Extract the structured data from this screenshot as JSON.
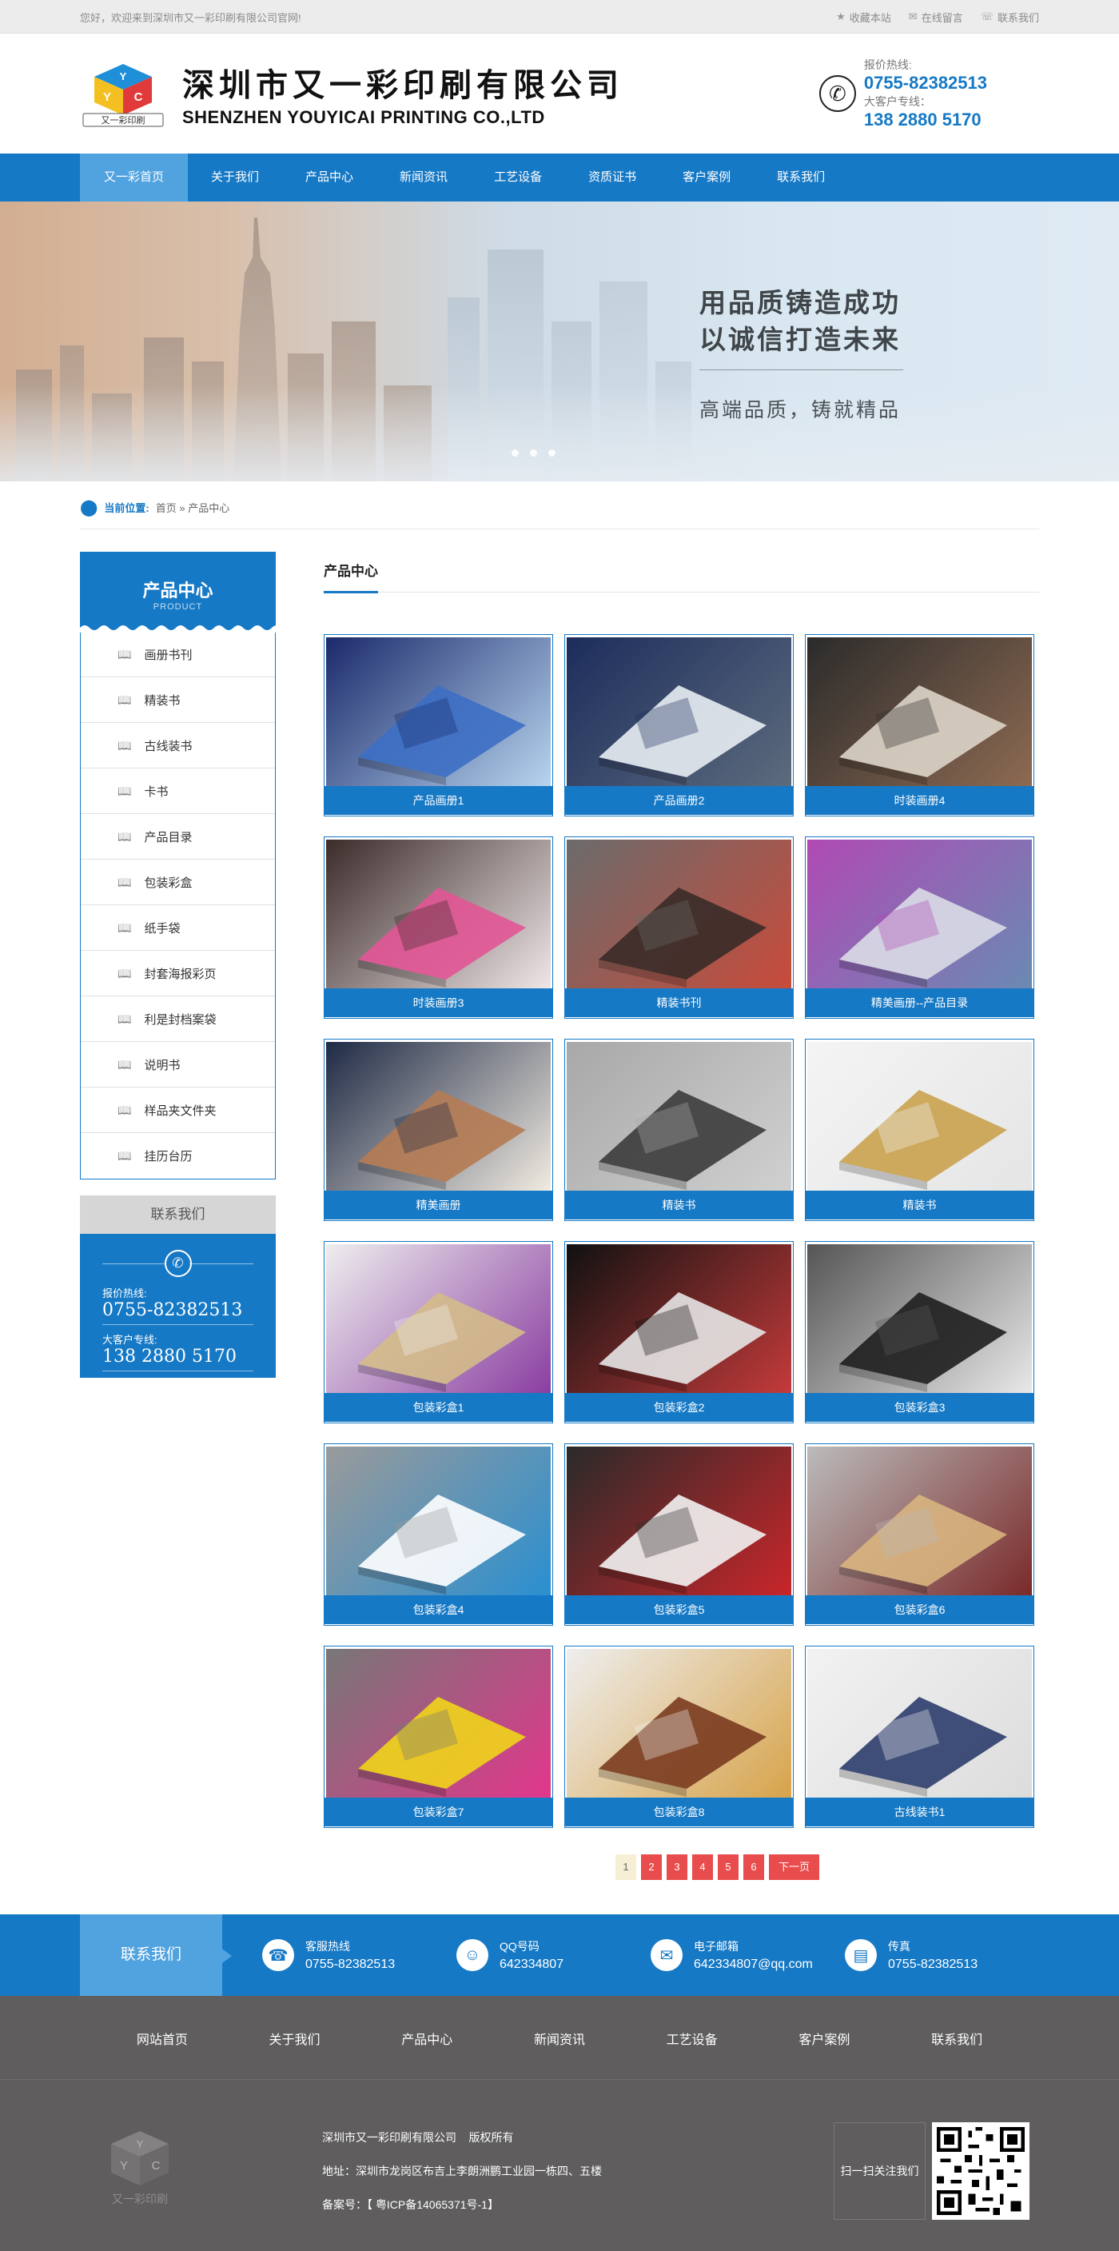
{
  "topbar": {
    "welcome": "您好，欢迎来到深圳市又一彩印刷有限公司官网!",
    "links": [
      {
        "label": "收藏本站",
        "icon": "star-icon"
      },
      {
        "label": "在线留言",
        "icon": "message-icon"
      },
      {
        "label": "联系我们",
        "icon": "chat-icon"
      }
    ]
  },
  "header": {
    "logo_badge": "又一彩印刷",
    "logo_cube_letters": [
      "Y",
      "Y",
      "C"
    ],
    "company_cn": "深圳市又一彩印刷有限公司",
    "company_en": "SHENZHEN YOUYICAI PRINTING CO.,LTD",
    "quote_label": "报价热线:",
    "quote_number": "0755-82382513",
    "vip_label": "大客户专线：",
    "vip_number": "138 2880 5170"
  },
  "nav": {
    "items": [
      "又一彩首页",
      "关于我们",
      "产品中心",
      "新闻资讯",
      "工艺设备",
      "资质证书",
      "客户案例",
      "联系我们"
    ],
    "active": 0
  },
  "banner": {
    "line1": "用品质铸造成功",
    "line2": "以诚信打造未来",
    "line3": "高端品质，铸就精品"
  },
  "breadcrumb": {
    "label": "当前位置:",
    "path": "首页 » 产品中心"
  },
  "sidebar": {
    "title": "产品中心",
    "subtitle": "PRODUCT",
    "items": [
      "画册书刊",
      "精装书",
      "古线装书",
      "卡书",
      "产品目录",
      "包装彩盒",
      "纸手袋",
      "封套海报彩页",
      "利是封档案袋",
      "说明书",
      "样品夹文件夹",
      "挂历台历"
    ],
    "contact_title": "联系我们",
    "quote_label": "报价热线:",
    "quote_number": "0755-82382513",
    "vip_label": "大客户专线:",
    "vip_number": "138 2880 5170"
  },
  "main": {
    "title": "产品中心",
    "products": [
      "产品画册1",
      "产品画册2",
      "时装画册4",
      "时装画册3",
      "精装书刊",
      "精美画册--产品目录",
      "精美画册",
      "精装书",
      "精装书",
      "包装彩盒1",
      "包装彩盒2",
      "包装彩盒3",
      "包装彩盒4",
      "包装彩盒5",
      "包装彩盒6",
      "包装彩盒7",
      "包装彩盒8",
      "古线装书1"
    ],
    "pages": [
      "1",
      "2",
      "3",
      "4",
      "5",
      "6"
    ],
    "next": "下一页"
  },
  "contact_bar": {
    "title": "联系我们",
    "items": [
      {
        "label": "客服热线",
        "value": "0755-82382513",
        "icon": "telephone-icon"
      },
      {
        "label": "QQ号码",
        "value": "642334807",
        "icon": "qq-icon"
      },
      {
        "label": "电子邮箱",
        "value": "642334807@qq.com",
        "icon": "email-icon"
      },
      {
        "label": "传真",
        "value": "0755-82382513",
        "icon": "fax-icon"
      }
    ]
  },
  "footer": {
    "nav": [
      "网站首页",
      "关于我们",
      "产品中心",
      "新闻资讯",
      "工艺设备",
      "客户案例",
      "联系我们"
    ],
    "logo_text": "又一彩印刷",
    "copyright": "深圳市又一彩印刷有限公司    版权所有",
    "address": "地址：深圳市龙岗区布吉上李朗洲鹏工业园一栋四、五楼",
    "icp": "备案号：【 粤ICP备14065371号-1】",
    "qr_label": "扫一扫关注我们"
  },
  "colors": {
    "brand_blue": "#1679c5",
    "nav_active": "#51a3e0",
    "pager_red": "#e84c4c",
    "footer_gray": "#5f5d5e"
  }
}
